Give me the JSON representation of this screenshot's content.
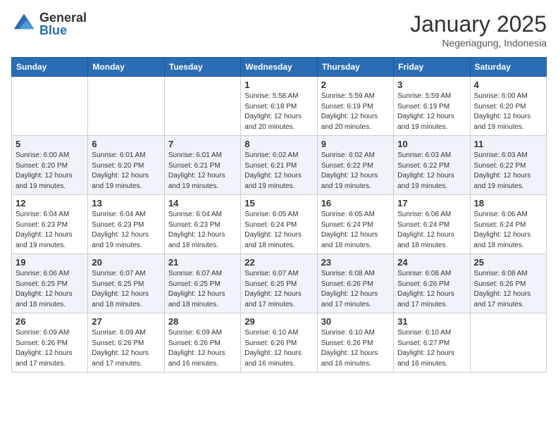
{
  "header": {
    "logo_general": "General",
    "logo_blue": "Blue",
    "month": "January 2025",
    "location": "Negeriagung, Indonesia"
  },
  "days_of_week": [
    "Sunday",
    "Monday",
    "Tuesday",
    "Wednesday",
    "Thursday",
    "Friday",
    "Saturday"
  ],
  "weeks": [
    [
      {
        "day": "",
        "info": ""
      },
      {
        "day": "",
        "info": ""
      },
      {
        "day": "",
        "info": ""
      },
      {
        "day": "1",
        "info": "Sunrise: 5:58 AM\nSunset: 6:18 PM\nDaylight: 12 hours and 20 minutes."
      },
      {
        "day": "2",
        "info": "Sunrise: 5:59 AM\nSunset: 6:19 PM\nDaylight: 12 hours and 20 minutes."
      },
      {
        "day": "3",
        "info": "Sunrise: 5:59 AM\nSunset: 6:19 PM\nDaylight: 12 hours and 19 minutes."
      },
      {
        "day": "4",
        "info": "Sunrise: 6:00 AM\nSunset: 6:20 PM\nDaylight: 12 hours and 19 minutes."
      }
    ],
    [
      {
        "day": "5",
        "info": "Sunrise: 6:00 AM\nSunset: 6:20 PM\nDaylight: 12 hours and 19 minutes."
      },
      {
        "day": "6",
        "info": "Sunrise: 6:01 AM\nSunset: 6:20 PM\nDaylight: 12 hours and 19 minutes."
      },
      {
        "day": "7",
        "info": "Sunrise: 6:01 AM\nSunset: 6:21 PM\nDaylight: 12 hours and 19 minutes."
      },
      {
        "day": "8",
        "info": "Sunrise: 6:02 AM\nSunset: 6:21 PM\nDaylight: 12 hours and 19 minutes."
      },
      {
        "day": "9",
        "info": "Sunrise: 6:02 AM\nSunset: 6:22 PM\nDaylight: 12 hours and 19 minutes."
      },
      {
        "day": "10",
        "info": "Sunrise: 6:03 AM\nSunset: 6:22 PM\nDaylight: 12 hours and 19 minutes."
      },
      {
        "day": "11",
        "info": "Sunrise: 6:03 AM\nSunset: 6:22 PM\nDaylight: 12 hours and 19 minutes."
      }
    ],
    [
      {
        "day": "12",
        "info": "Sunrise: 6:04 AM\nSunset: 6:23 PM\nDaylight: 12 hours and 19 minutes."
      },
      {
        "day": "13",
        "info": "Sunrise: 6:04 AM\nSunset: 6:23 PM\nDaylight: 12 hours and 19 minutes."
      },
      {
        "day": "14",
        "info": "Sunrise: 6:04 AM\nSunset: 6:23 PM\nDaylight: 12 hours and 18 minutes."
      },
      {
        "day": "15",
        "info": "Sunrise: 6:05 AM\nSunset: 6:24 PM\nDaylight: 12 hours and 18 minutes."
      },
      {
        "day": "16",
        "info": "Sunrise: 6:05 AM\nSunset: 6:24 PM\nDaylight: 12 hours and 18 minutes."
      },
      {
        "day": "17",
        "info": "Sunrise: 6:06 AM\nSunset: 6:24 PM\nDaylight: 12 hours and 18 minutes."
      },
      {
        "day": "18",
        "info": "Sunrise: 6:06 AM\nSunset: 6:24 PM\nDaylight: 12 hours and 18 minutes."
      }
    ],
    [
      {
        "day": "19",
        "info": "Sunrise: 6:06 AM\nSunset: 6:25 PM\nDaylight: 12 hours and 18 minutes."
      },
      {
        "day": "20",
        "info": "Sunrise: 6:07 AM\nSunset: 6:25 PM\nDaylight: 12 hours and 18 minutes."
      },
      {
        "day": "21",
        "info": "Sunrise: 6:07 AM\nSunset: 6:25 PM\nDaylight: 12 hours and 18 minutes."
      },
      {
        "day": "22",
        "info": "Sunrise: 6:07 AM\nSunset: 6:25 PM\nDaylight: 12 hours and 17 minutes."
      },
      {
        "day": "23",
        "info": "Sunrise: 6:08 AM\nSunset: 6:26 PM\nDaylight: 12 hours and 17 minutes."
      },
      {
        "day": "24",
        "info": "Sunrise: 6:08 AM\nSunset: 6:26 PM\nDaylight: 12 hours and 17 minutes."
      },
      {
        "day": "25",
        "info": "Sunrise: 6:08 AM\nSunset: 6:26 PM\nDaylight: 12 hours and 17 minutes."
      }
    ],
    [
      {
        "day": "26",
        "info": "Sunrise: 6:09 AM\nSunset: 6:26 PM\nDaylight: 12 hours and 17 minutes."
      },
      {
        "day": "27",
        "info": "Sunrise: 6:09 AM\nSunset: 6:26 PM\nDaylight: 12 hours and 17 minutes."
      },
      {
        "day": "28",
        "info": "Sunrise: 6:09 AM\nSunset: 6:26 PM\nDaylight: 12 hours and 16 minutes."
      },
      {
        "day": "29",
        "info": "Sunrise: 6:10 AM\nSunset: 6:26 PM\nDaylight: 12 hours and 16 minutes."
      },
      {
        "day": "30",
        "info": "Sunrise: 6:10 AM\nSunset: 6:26 PM\nDaylight: 12 hours and 16 minutes."
      },
      {
        "day": "31",
        "info": "Sunrise: 6:10 AM\nSunset: 6:27 PM\nDaylight: 12 hours and 16 minutes."
      },
      {
        "day": "",
        "info": ""
      }
    ]
  ]
}
